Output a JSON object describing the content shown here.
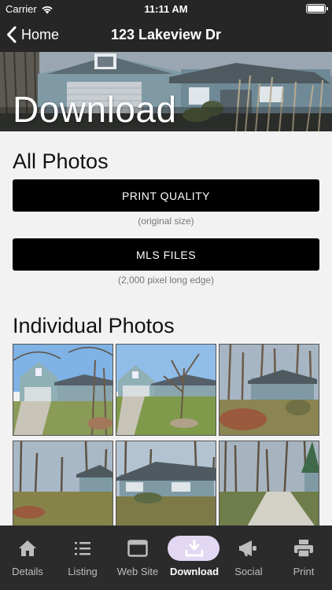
{
  "status": {
    "carrier": "Carrier",
    "time": "11:11 AM"
  },
  "nav": {
    "back_label": "Home",
    "title": "123 Lakeview Dr"
  },
  "hero": {
    "title": "Download"
  },
  "all_photos": {
    "heading": "All Photos",
    "print_quality": {
      "label": "PRINT QUALITY",
      "note": "(original size)"
    },
    "mls_files": {
      "label": "MLS FILES",
      "note": "(2,000 pixel long edge)"
    }
  },
  "individual": {
    "heading": "Individual Photos"
  },
  "tabs": [
    {
      "label": "Details",
      "icon": "home-icon",
      "active": false
    },
    {
      "label": "Listing",
      "icon": "list-icon",
      "active": false
    },
    {
      "label": "Web Site",
      "icon": "browser-icon",
      "active": false
    },
    {
      "label": "Download",
      "icon": "download-icon",
      "active": true
    },
    {
      "label": "Social",
      "icon": "megaphone-icon",
      "active": false
    },
    {
      "label": "Print",
      "icon": "printer-icon",
      "active": false
    }
  ],
  "colors": {
    "bar": "#262626",
    "accent_pill": "#e2d8f3",
    "button": "#000000"
  }
}
